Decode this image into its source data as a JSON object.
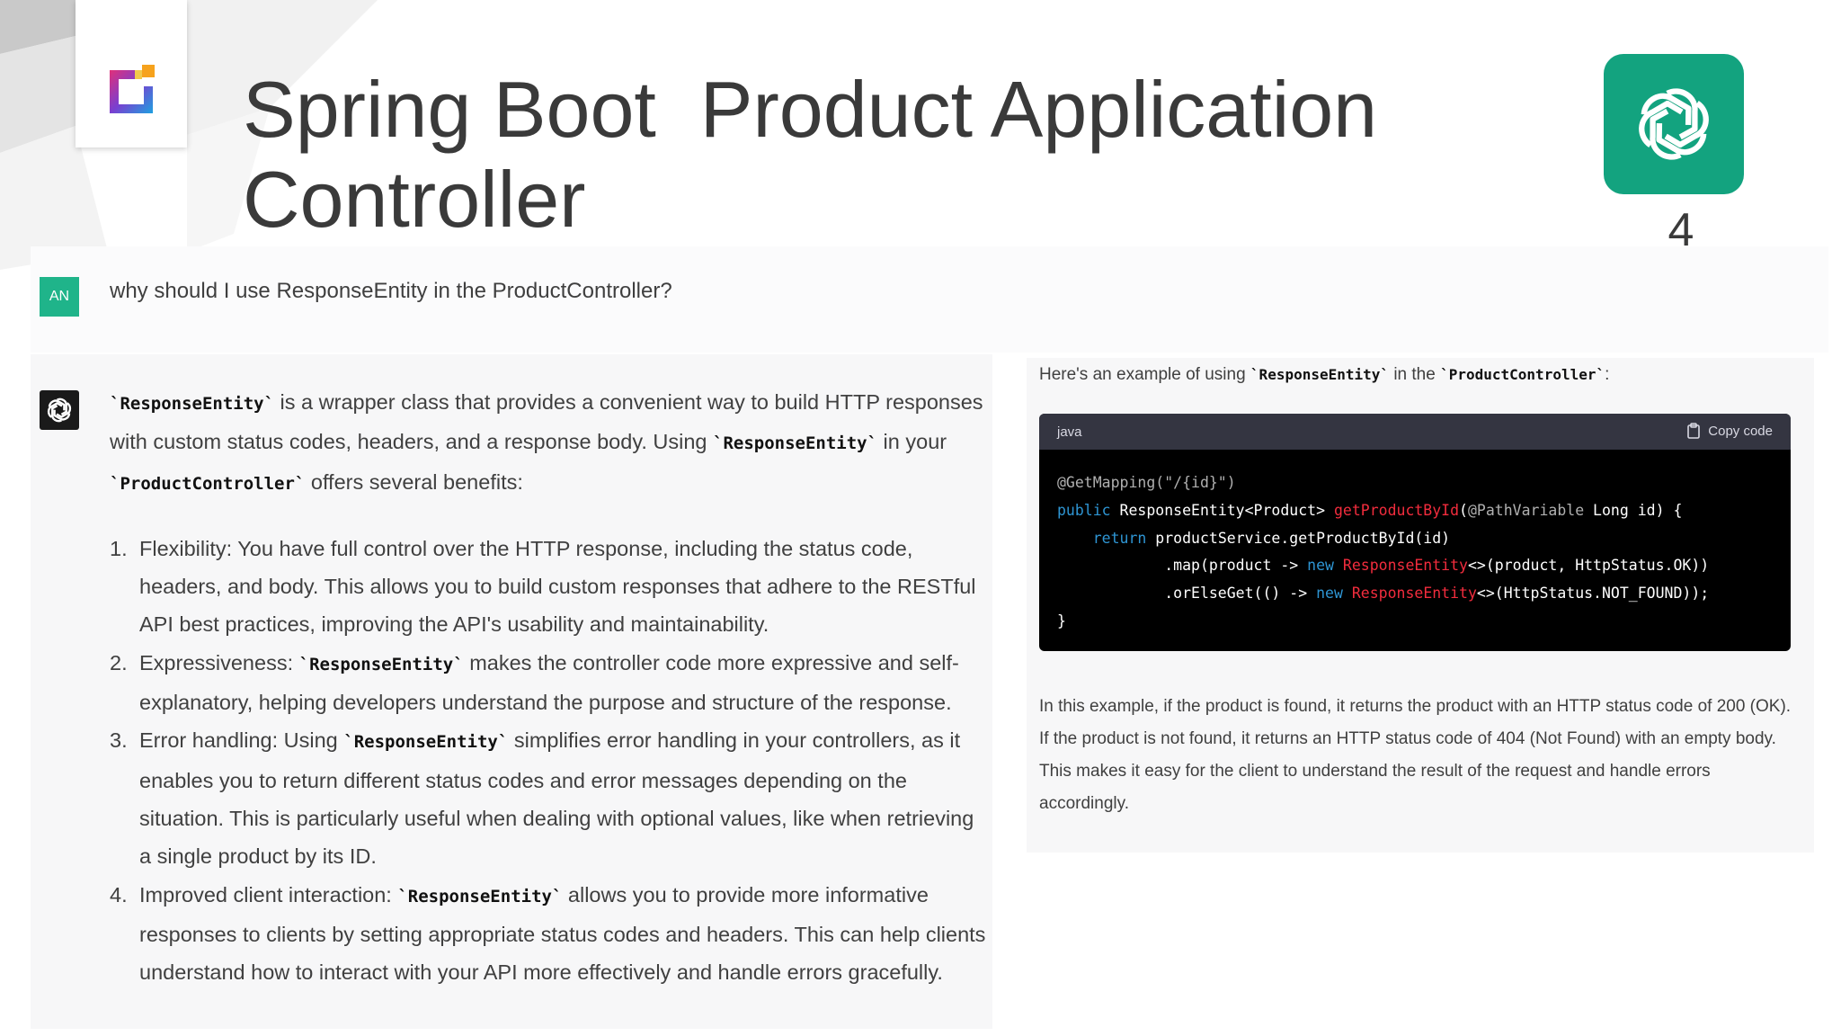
{
  "slide": {
    "title": "Spring Boot  Product Application Controller",
    "number": "4",
    "accent_color": "#13a37f"
  },
  "icons": {
    "brand_logo": "brand-logo-icon",
    "openai_badge": "openai-logo-icon"
  },
  "chat": {
    "user_avatar": "AN",
    "user_question": "why should I use ResponseEntity in the ProductController?",
    "answer": {
      "intro": {
        "code1": "`ResponseEntity`",
        "text1": " is a wrapper class that provides a convenient way to build HTTP responses with custom status codes, headers, and a response body. Using ",
        "code2": "`ResponseEntity`",
        "text2": " in your ",
        "code3": "`ProductController`",
        "text3": " offers several benefits:"
      },
      "benefits": [
        {
          "num": "1.",
          "text": "Flexibility: You have full control over the HTTP response, including the status code, headers, and body. This allows you to build custom responses that adhere to the RESTful API best practices, improving the API's usability and maintainability."
        },
        {
          "num": "2.",
          "prefix": "Expressiveness: ",
          "code": "`ResponseEntity`",
          "suffix": " makes the controller code more expressive and self-explanatory, helping developers understand the purpose and structure of the response."
        },
        {
          "num": "3.",
          "prefix": "Error handling: Using ",
          "code": "`ResponseEntity`",
          "suffix": " simplifies error handling in your controllers, as it enables you to return different status codes and error messages depending on the situation. This is particularly useful when dealing with optional values, like when retrieving a single product by its ID."
        },
        {
          "num": "4.",
          "prefix": "Improved client interaction: ",
          "code": "`ResponseEntity`",
          "suffix": " allows you to provide more informative responses to clients by setting appropriate status codes and headers. This can help clients understand how to interact with your API more effectively and handle errors gracefully."
        }
      ]
    },
    "example": {
      "intro_prefix": "Here's an example of using ",
      "intro_code1": "`ResponseEntity`",
      "intro_mid": " in the ",
      "intro_code2": "`ProductController`",
      "intro_suffix": ":",
      "code_language": "java",
      "copy_label": "Copy code",
      "code_lines": [
        [
          "@GetMapping(\"/{id}\")"
        ],
        [
          "public",
          " ResponseEntity<Product> ",
          "getProductById",
          "(",
          "@PathVariable",
          " Long id) {"
        ],
        [
          "    ",
          "return",
          " productService.getProductById(id)"
        ],
        [
          "            .map(product -> ",
          "new",
          " ",
          "ResponseEntity",
          "<>(product, HttpStatus.OK))"
        ],
        [
          "            .orElseGet(() -> ",
          "new",
          " ",
          "ResponseEntity",
          "<>(HttpStatus.NOT_FOUND));"
        ],
        [
          "}"
        ]
      ],
      "outro": "In this example, if the product is found, it returns the product with an HTTP status code of 200 (OK). If the product is not found, it returns an HTTP status code of 404 (Not Found) with an empty body. This makes it easy for the client to understand the result of the request and handle errors accordingly."
    }
  }
}
